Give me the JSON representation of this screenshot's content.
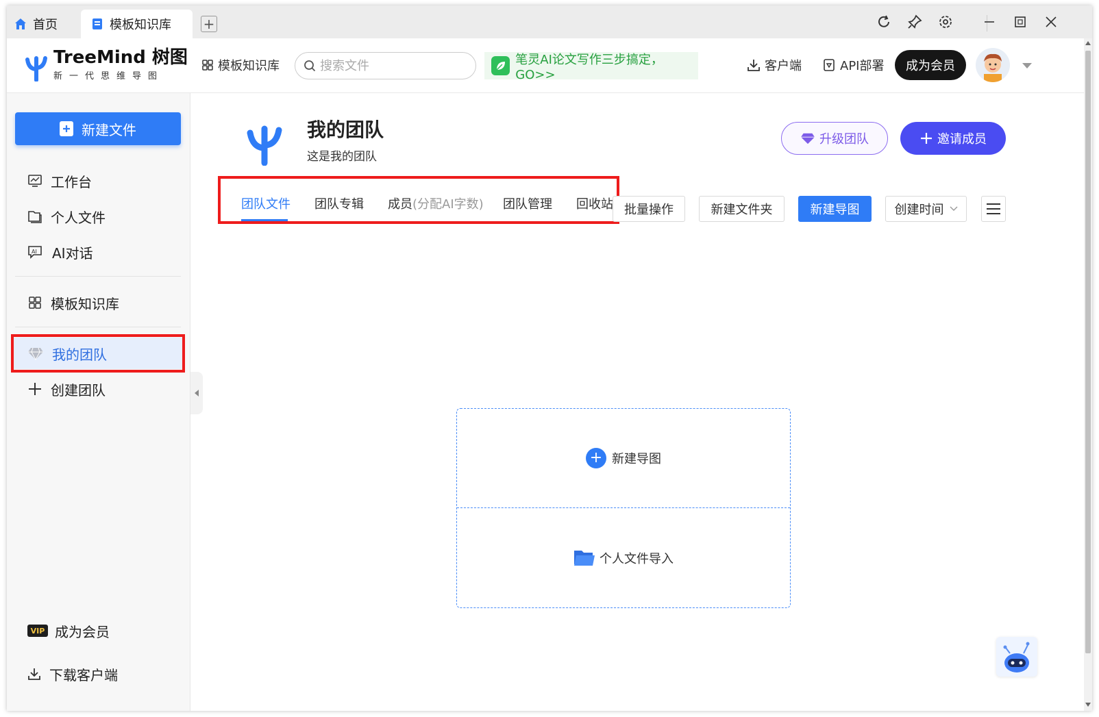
{
  "tabs": {
    "home_label": "首页",
    "active_label": "模板知识库",
    "add_label": "+"
  },
  "header": {
    "logo_title": "TreeMind 树图",
    "logo_subtitle": "新一代思维导图",
    "templates_link": "模板知识库",
    "search_placeholder": "搜索文件",
    "promo_text": "笔灵AI论文写作三步搞定，GO>>",
    "client_link": "客户端",
    "api_link": "API部署",
    "vip_button": "成为会员"
  },
  "sidebar": {
    "new_file": "新建文件",
    "items": [
      {
        "label": "工作台",
        "icon": "monitor-icon"
      },
      {
        "label": "个人文件",
        "icon": "folder-icon"
      },
      {
        "label": "AI对话",
        "icon": "ai-chat-icon"
      },
      {
        "label": "模板知识库",
        "icon": "grid-icon"
      },
      {
        "label": "我的团队",
        "icon": "diamond-icon"
      },
      {
        "label": "创建团队",
        "icon": "plus-icon"
      }
    ],
    "vip_label": "成为会员",
    "vip_badge": "VIP",
    "download_label": "下载客户端"
  },
  "team": {
    "name": "我的团队",
    "description": "这是我的团队",
    "upgrade_button": "升级团队",
    "invite_button": "邀请成员"
  },
  "team_tabs": [
    {
      "label": "团队文件",
      "active": true
    },
    {
      "label": "团队专辑",
      "active": false
    },
    {
      "label": "成员",
      "suffix": "(分配AI字数)",
      "active": false
    },
    {
      "label": "团队管理",
      "active": false
    },
    {
      "label": "回收站",
      "active": false
    }
  ],
  "toolbar": {
    "batch": "批量操作",
    "new_folder": "新建文件夹",
    "new_map": "新建导图",
    "sort": "创建时间"
  },
  "empty_state": {
    "new_map": "新建导图",
    "import": "个人文件导入"
  },
  "colors": {
    "primary": "#2f7cf6",
    "invite": "#4a4cf2",
    "highlight": "#ee1c1c",
    "promo_green": "#27a03f"
  }
}
